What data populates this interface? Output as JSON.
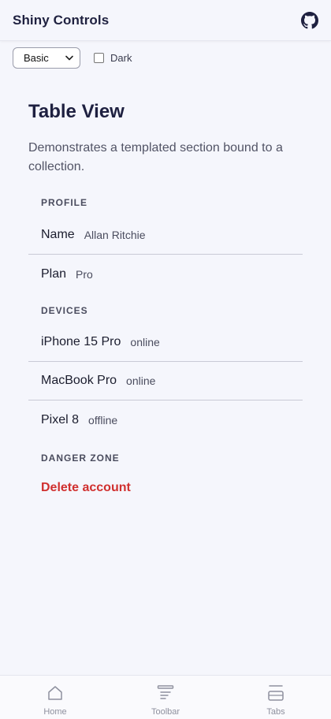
{
  "header": {
    "title": "Shiny Controls",
    "github_icon": "github-icon"
  },
  "controls": {
    "theme_select": {
      "value": "Basic",
      "options": [
        "Basic"
      ]
    },
    "dark_toggle": {
      "label": "Dark",
      "checked": false
    }
  },
  "page": {
    "title": "Table View",
    "description": "Demonstrates a templated section bound to a collection."
  },
  "sections": {
    "profile": {
      "header": "PROFILE",
      "rows": [
        {
          "title": "Name",
          "detail": "Allan Ritchie"
        },
        {
          "title": "Plan",
          "detail": "Pro"
        }
      ]
    },
    "devices": {
      "header": "DEVICES",
      "rows": [
        {
          "title": "iPhone 15 Pro",
          "detail": "online"
        },
        {
          "title": "MacBook Pro",
          "detail": "online"
        },
        {
          "title": "Pixel 8",
          "detail": "offline"
        }
      ]
    },
    "danger": {
      "header": "DANGER ZONE",
      "action": "Delete account"
    }
  },
  "tabs": [
    {
      "label": "Home",
      "icon": "home-icon"
    },
    {
      "label": "Toolbar",
      "icon": "toolbar-icon"
    },
    {
      "label": "Tabs",
      "icon": "tabs-icon"
    }
  ],
  "colors": {
    "background": "#f5f6fc",
    "title": "#1e2040",
    "danger": "#d0302f",
    "muted": "#8e909e"
  }
}
